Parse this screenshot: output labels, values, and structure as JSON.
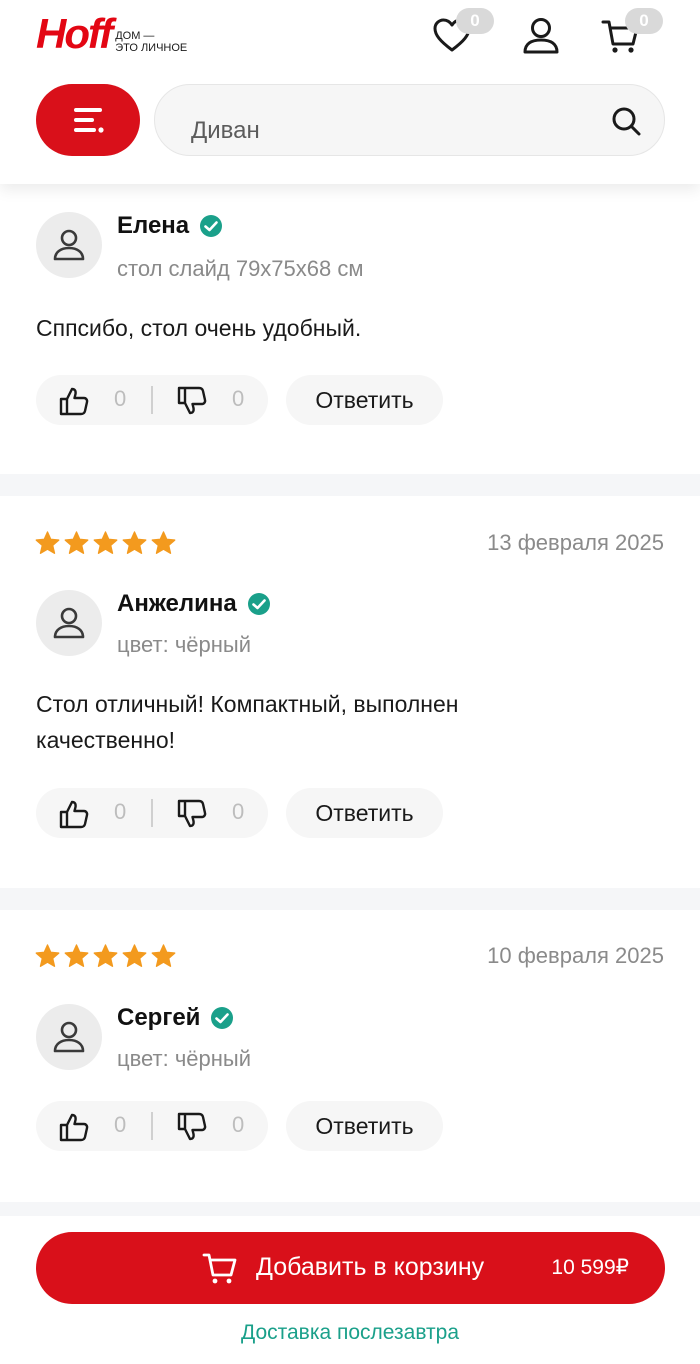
{
  "header": {
    "logo_text": "Hoff",
    "logo_tagline_line1": "ДОМ —",
    "logo_tagline_line2": "ЭТО ЛИЧНОЕ",
    "favorites_count": "0",
    "cart_count": "0",
    "search_value": "Диван"
  },
  "reviews": [
    {
      "name": "Елена",
      "meta": "стол слайд 79х75х68 см",
      "text": "Сппсибо, стол очень удобный.",
      "likes": "0",
      "dislikes": "0",
      "reply_label": "Ответить"
    },
    {
      "rating": 5,
      "date": "13 февраля 2025",
      "name": "Анжелина",
      "meta": "цвет: чёрный",
      "text": "Стол отличный! Компактный, выполнен качественно!",
      "likes": "0",
      "dislikes": "0",
      "reply_label": "Ответить"
    },
    {
      "rating": 5,
      "date": "10 февраля 2025",
      "name": "Сергей",
      "meta": "цвет: чёрный",
      "likes": "0",
      "dislikes": "0",
      "reply_label": "Ответить"
    }
  ],
  "bottom_bar": {
    "add_to_cart_label": "Добавить в корзину",
    "price": "10 599₽",
    "delivery_text": "Доставка послезавтра"
  },
  "colors": {
    "brand_red": "#d9101a",
    "star": "#f39a1e",
    "verified": "#1aa08a",
    "delivery": "#1aa08a"
  },
  "icons": [
    "heart-icon",
    "user-icon",
    "cart-icon",
    "menu-icon",
    "search-icon",
    "verified-icon",
    "thumbs-up-icon",
    "thumbs-down-icon",
    "star-icon"
  ]
}
